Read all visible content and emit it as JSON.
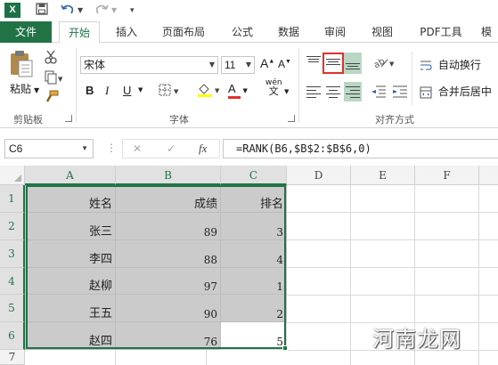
{
  "qat": {
    "app_logo": "X",
    "save_icon": "save-icon",
    "undo_icon": "undo-icon",
    "redo_icon": "redo-icon",
    "customize_icon": "customize-qat-icon"
  },
  "ribbon_tabs": [
    {
      "label": "文件"
    },
    {
      "label": "开始"
    },
    {
      "label": "插入"
    },
    {
      "label": "页面布局"
    },
    {
      "label": "公式"
    },
    {
      "label": "数据"
    },
    {
      "label": "审阅"
    },
    {
      "label": "视图"
    },
    {
      "label": "PDF工具"
    },
    {
      "label": "模"
    }
  ],
  "clipboard": {
    "paste_label": "粘贴",
    "group_label": "剪贴板"
  },
  "font": {
    "font_name": "宋体",
    "font_size": "11",
    "bold": "B",
    "italic": "I",
    "underline": "U",
    "grow": "A",
    "shrink": "A",
    "font_color_letter": "A",
    "phonetic_top": "wén",
    "phonetic_bottom": "文",
    "group_label": "字体"
  },
  "alignment": {
    "wrap_text": "自动换行",
    "merge_center": "合并后居中",
    "group_label": "对齐方式"
  },
  "formula_bar": {
    "name_box": "C6",
    "cancel": "✕",
    "enter": "✓",
    "fx": "fx",
    "formula": "=RANK(B6,$B$2:$B$6,0)"
  },
  "grid": {
    "columns": [
      "A",
      "B",
      "C",
      "D",
      "E",
      "F"
    ],
    "rows": [
      "1",
      "2",
      "3",
      "4",
      "5",
      "6",
      "7"
    ],
    "cells": [
      [
        "姓名",
        "成绩",
        "排名"
      ],
      [
        "张三",
        "89",
        "3"
      ],
      [
        "李四",
        "88",
        "4"
      ],
      [
        "赵柳",
        "97",
        "1"
      ],
      [
        "王五",
        "90",
        "2"
      ],
      [
        "赵四",
        "76",
        "5"
      ]
    ]
  },
  "watermark": "河南龙网",
  "colors": {
    "excel_green": "#217346",
    "selection_gray": "#cbcbcb",
    "highlight_red": "#e0312a"
  }
}
